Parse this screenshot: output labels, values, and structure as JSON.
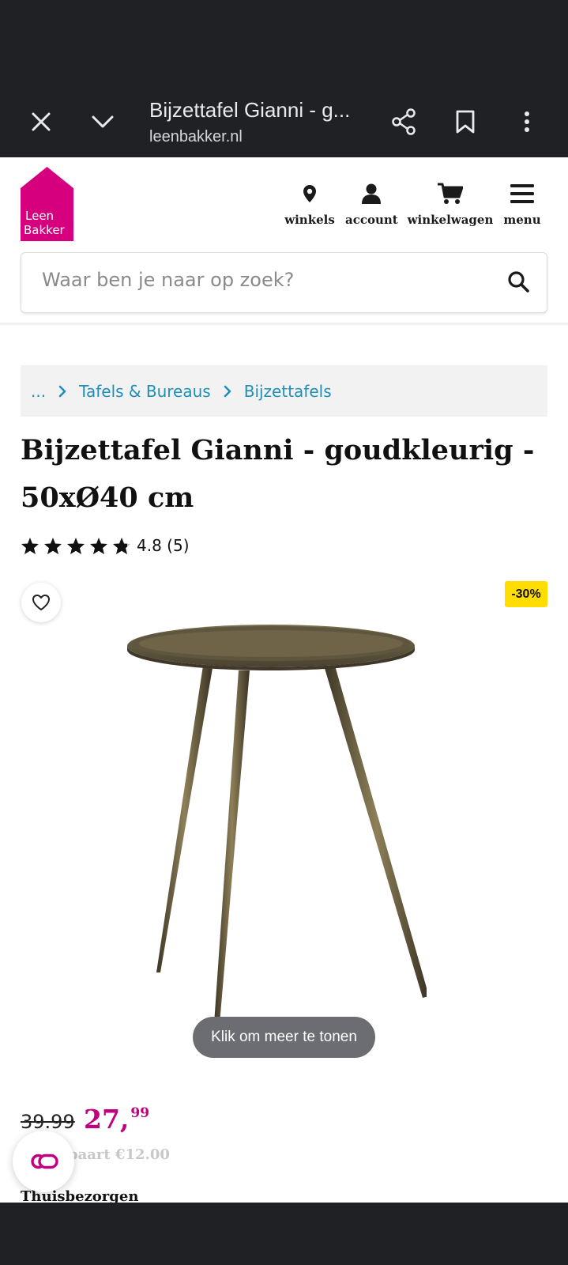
{
  "browser": {
    "tab_title": "Bijzettafel Gianni - g...",
    "url": "leenbakker.nl"
  },
  "header": {
    "logo_line1": "Leen",
    "logo_line2": "Bakker",
    "brand_color": "#d6007e",
    "nav": [
      {
        "label": "winkels",
        "icon": "location-pin-icon"
      },
      {
        "label": "account",
        "icon": "user-icon"
      },
      {
        "label": "winkelwagen",
        "icon": "cart-icon"
      },
      {
        "label": "menu",
        "icon": "hamburger-menu-icon"
      }
    ],
    "search_placeholder": "Waar ben je naar op zoek?"
  },
  "breadcrumb": {
    "ellipsis": "...",
    "items": [
      "Tafels & Bureaus",
      "Bijzettafels"
    ]
  },
  "product": {
    "title": "Bijzettafel Gianni - goudkleurig - 50xØ40 cm",
    "rating_value": 4.8,
    "rating_text": "4.8 (5)",
    "star_count": 5,
    "discount_badge": "-30%",
    "image_toast": "Klik om meer te tonen",
    "price_old": "39.99",
    "price_new_main": "27,",
    "price_new_cents": "99",
    "savings_text": "paart €12.00",
    "delivery_label": "Thuisbezorgen"
  },
  "colors": {
    "accent_price": "#c10080",
    "link": "#1f8fb8",
    "badge": "#ffdd00",
    "chrome": "#202125"
  }
}
